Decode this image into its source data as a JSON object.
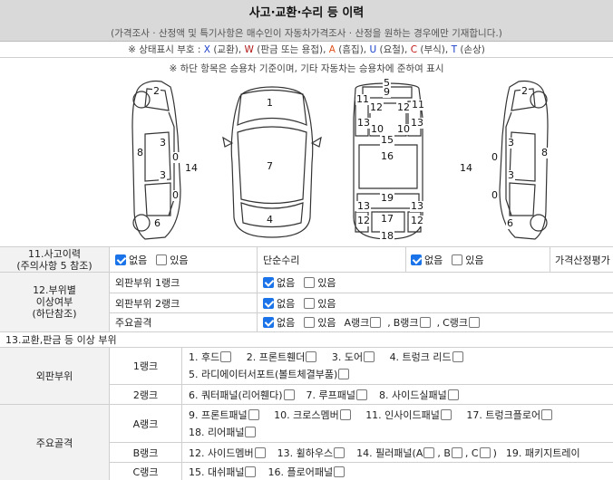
{
  "header": {
    "title": "사고·교환·수리 등 이력",
    "subtitle": "(가격조사 · 산정액 및 특기사항은 매수인이 자동차가격조사 · 산정을 원하는 경우에만 기재합니다.)"
  },
  "legend": {
    "prefix": "※ 상태표시 부호 : ",
    "items": [
      {
        "code": "X",
        "text": " (교환), "
      },
      {
        "code": "W",
        "text": " (판금 또는 용접), "
      },
      {
        "code": "A",
        "text": " (흠집), "
      },
      {
        "code": "U",
        "text": " (요철), "
      },
      {
        "code": "C",
        "text": " (부식), "
      },
      {
        "code": "T",
        "text": " (손상)"
      }
    ],
    "note": "※ 하단 항목은 승용차 기준이며, 기타 자동차는 승용차에 준하여 표시"
  },
  "diagram_labels": {
    "left_side": [
      "2",
      "3",
      "8",
      "0",
      "3",
      "0",
      "14",
      "6"
    ],
    "front": [
      "1",
      "7",
      "4"
    ],
    "top_view": [
      "5",
      "9",
      "11",
      "11",
      "12",
      "12",
      "13",
      "13",
      "10",
      "10",
      "15",
      "16",
      "19",
      "13",
      "13",
      "12",
      "17",
      "12",
      "18"
    ],
    "right_side": [
      "2",
      "3",
      "0",
      "14",
      "3",
      "0",
      "8",
      "6"
    ]
  },
  "history": {
    "accident": {
      "label": "11.사고이력",
      "sublabel": "(주의사항 5 참조)",
      "none": "없음",
      "yes": "있음",
      "none_checked": true
    },
    "simple_repair": {
      "label": "단순수리",
      "none": "없음",
      "yes": "있음",
      "none_checked": true
    },
    "price_label": "가격산정평가"
  },
  "parts_status": {
    "label": "12.부위별",
    "label2": "이상여부",
    "label3": "(하단참조)",
    "rows": [
      {
        "name": "외판부위 1랭크",
        "none": "없음",
        "yes": "있음"
      },
      {
        "name": "외판부위 2랭크",
        "none": "없음",
        "yes": "있음"
      },
      {
        "name": "주요골격",
        "none": "없음",
        "yes": "있음",
        "ranks": [
          "A랭크",
          "B랭크",
          "C랭크"
        ]
      }
    ]
  },
  "section13": {
    "title": "13.교환,판금 등 이상 부위",
    "outer": {
      "label": "외판부위",
      "rank1": {
        "label": "1랭크",
        "line1": [
          "1. 후드",
          "2. 프론트휀더",
          "3. 도어",
          "4. 트렁크 리드"
        ],
        "line2": [
          "5. 라디에이터서포트(볼트체결부품)"
        ]
      },
      "rank2": {
        "label": "2랭크",
        "line1": [
          "6. 쿼터패널(리어휀다)",
          "7. 루프패널",
          "8. 사이드실패널"
        ]
      }
    },
    "frame": {
      "label": "주요골격",
      "a": {
        "label": "A랭크",
        "line1": [
          "9. 프론트패널",
          "10. 크로스멤버",
          "11. 인사이드패널",
          "17. 트렁크플로어"
        ],
        "line2": [
          "18. 리어패널"
        ]
      },
      "b": {
        "label": "B랭크",
        "pre": [
          "12. 사이드멤버",
          "13. 휠하우스"
        ],
        "pillar_prefix": "14. 필러패널(A",
        "pillar_b": ", B",
        "pillar_c": ", C",
        "pillar_end": ")",
        "post": "19. 패키지트레이"
      },
      "c": {
        "label": "C랭크",
        "line1": [
          "15. 대쉬패널",
          "16. 플로어패널"
        ]
      }
    }
  }
}
